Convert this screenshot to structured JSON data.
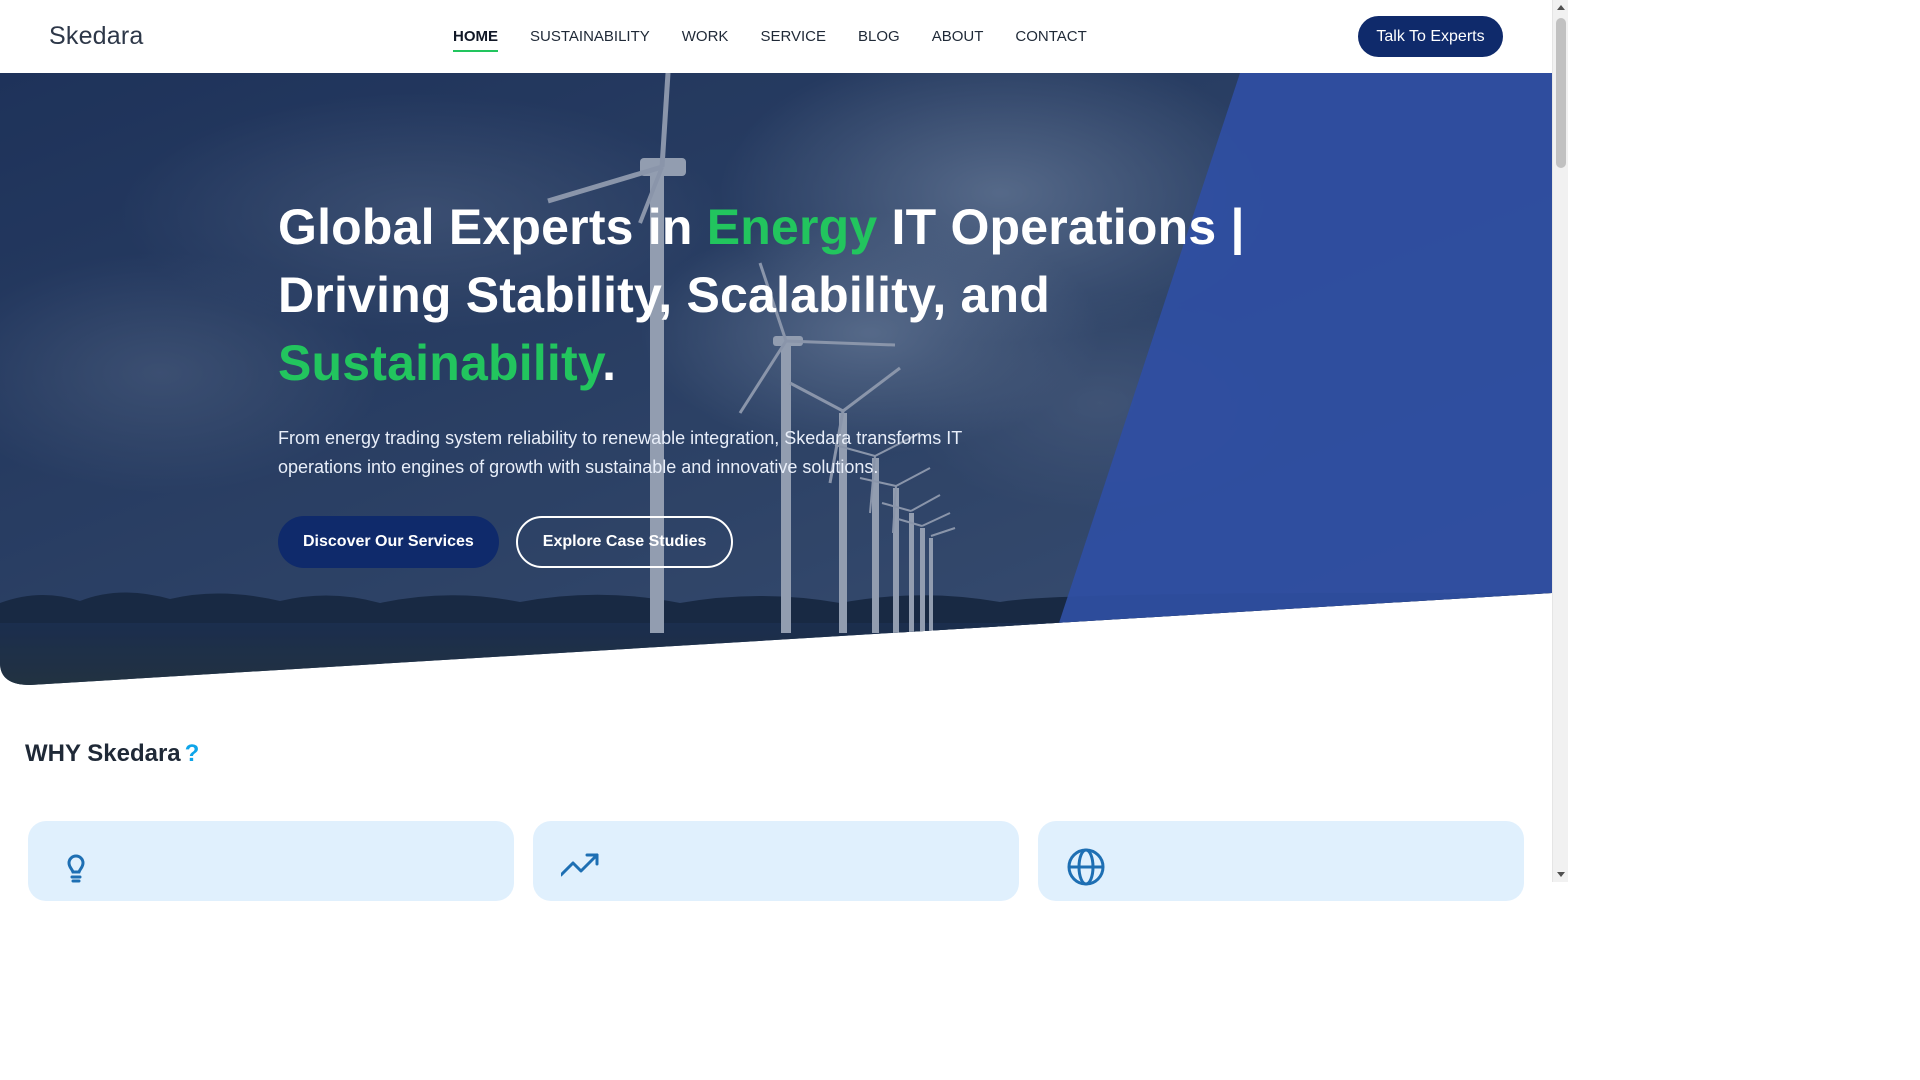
{
  "header": {
    "logo": "Skedara",
    "nav": [
      "HOME",
      "SUSTAINABILITY",
      "WORK",
      "SERVICE",
      "BLOG",
      "ABOUT",
      "CONTACT"
    ],
    "active_nav": "HOME",
    "cta": "Talk To Experts"
  },
  "hero": {
    "title_part1": "Global Experts in ",
    "title_highlight1": "Energy",
    "title_part2": " IT Operations | Driving Stability, Scalability, and ",
    "title_highlight2": "Sustainability",
    "title_part3": ".",
    "subtitle": "From energy trading system reliability to renewable integration, Skedara transforms IT operations into engines of growth with sustainable and innovative solutions.",
    "primary_button": "Discover Our Services",
    "secondary_button": "Explore Case Studies"
  },
  "why": {
    "prefix": "WHY",
    "brand": "Skedara",
    "suffix": "?"
  },
  "cards": [
    {
      "icon": "lightbulb-icon"
    },
    {
      "icon": "trending-up-icon"
    },
    {
      "icon": "globe-icon"
    }
  ],
  "colors": {
    "navy": "#0f2a6b",
    "green": "#22c55e",
    "card_bg": "#e0f0fd",
    "question_mark": "#0ea5e9"
  }
}
